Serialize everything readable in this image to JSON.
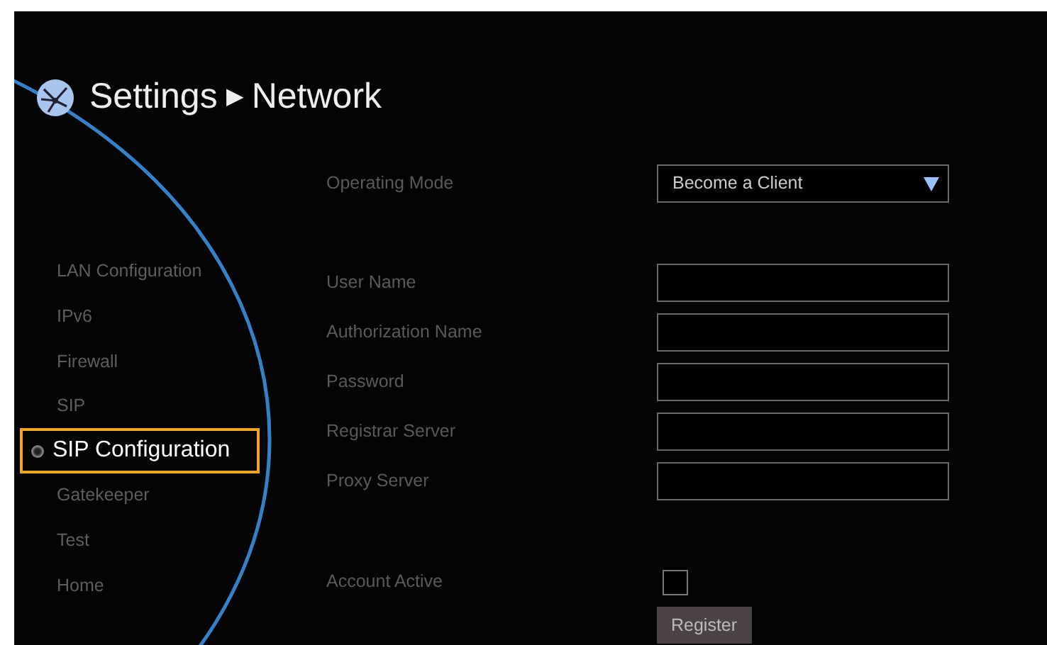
{
  "header": {
    "title": "Settings",
    "separator": "▶",
    "subtitle": "Network"
  },
  "sidebar": {
    "items": [
      {
        "label": "LAN Configuration",
        "selected": false
      },
      {
        "label": "IPv6",
        "selected": false
      },
      {
        "label": "Firewall",
        "selected": false
      },
      {
        "label": "SIP",
        "selected": false
      },
      {
        "label": "SIP Configuration",
        "selected": true
      },
      {
        "label": "Gatekeeper",
        "selected": false
      },
      {
        "label": "Test",
        "selected": false
      },
      {
        "label": "Home",
        "selected": false
      }
    ]
  },
  "operating_mode": {
    "label": "Operating Mode",
    "value": "Become a Client"
  },
  "fields": [
    {
      "label": "User Name"
    },
    {
      "label": "Authorization Name"
    },
    {
      "label": "Password"
    },
    {
      "label": "Registrar Server"
    },
    {
      "label": "Proxy Server"
    }
  ],
  "account_active": {
    "label": "Account Active",
    "checked": false
  },
  "buttons": [
    "Register"
  ]
}
